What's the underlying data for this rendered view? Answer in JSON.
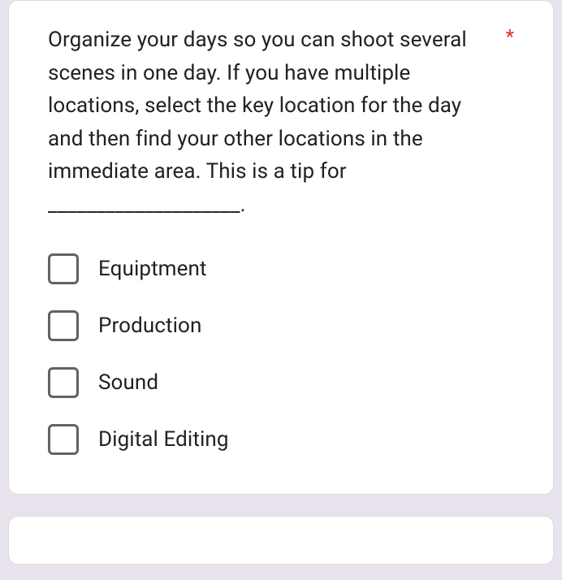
{
  "question": {
    "text": "Organize your days so you can shoot several scenes in one day. If you have multiple locations, select the key location for the day and then find your other locations in the immediate area.  This is a tip for ____________________.",
    "required_marker": "*",
    "options": [
      {
        "label": "Equiptment"
      },
      {
        "label": "Production"
      },
      {
        "label": "Sound"
      },
      {
        "label": "Digital Editing"
      }
    ]
  }
}
